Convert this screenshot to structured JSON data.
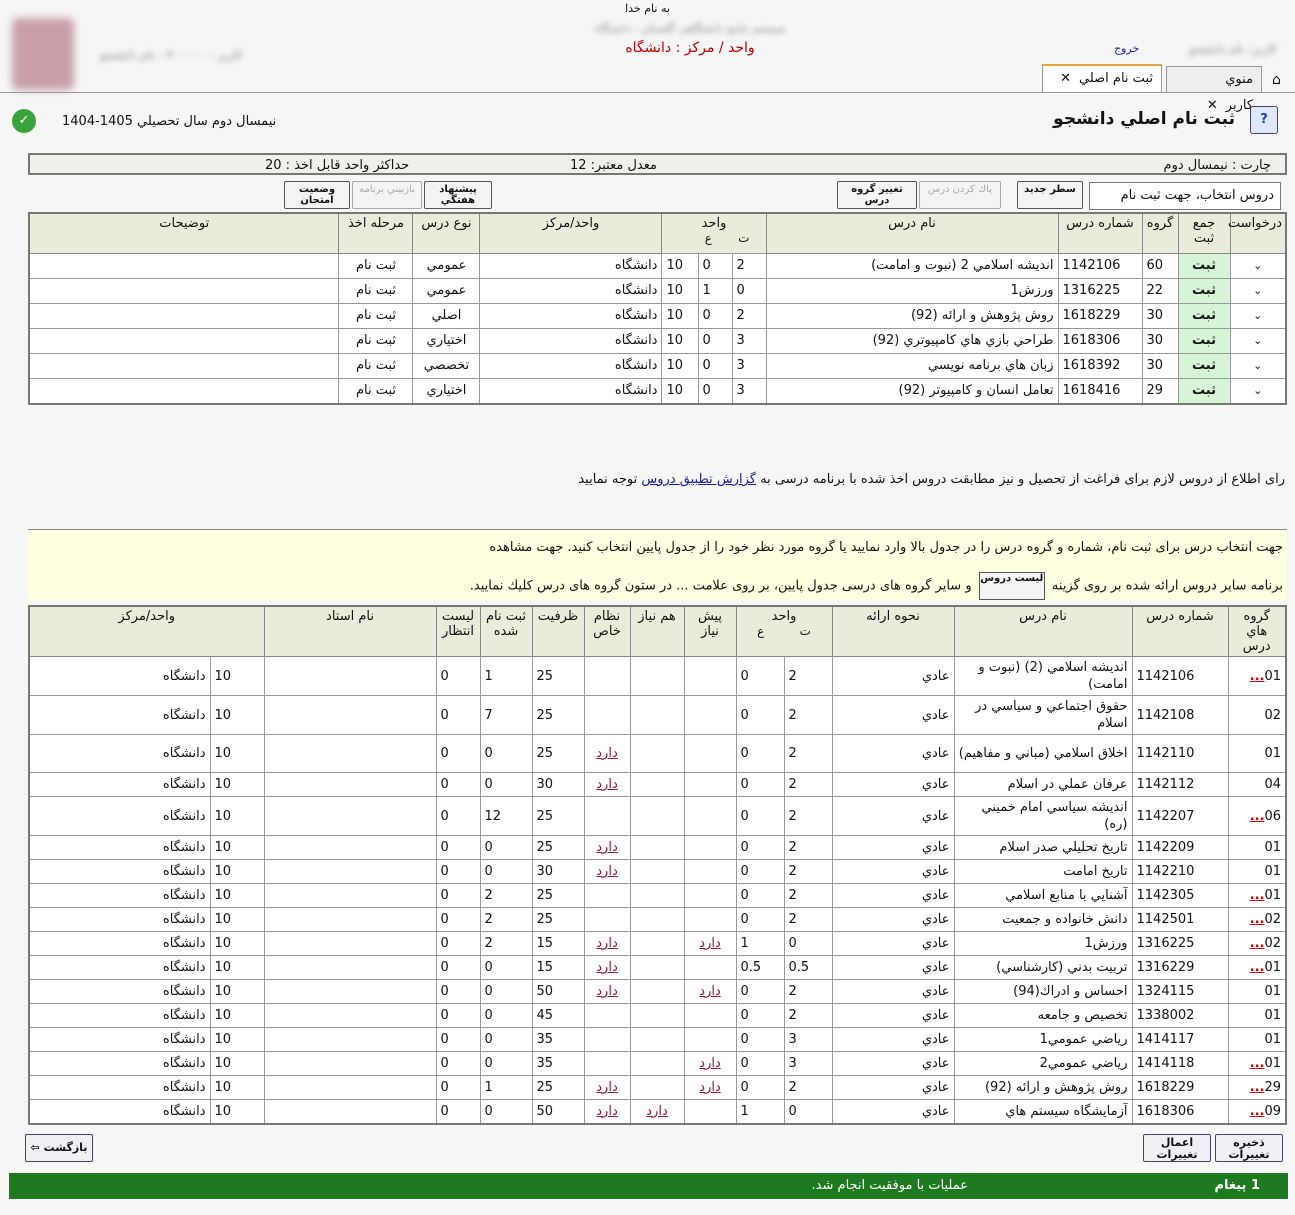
{
  "header": {
    "bismillah": "به نام خدا",
    "university_blurred": "سیستم جامع دانشگاهی گلستان - دانشگاه",
    "unit_line": "واحد / مرکز : دانشگاه",
    "user_blurred": "کاربر : ۴۰۰۰۰۰ - نام دانشجو",
    "user_right_blurred": "کاربر: نام دانشجو",
    "logout": "خروج"
  },
  "tabs": [
    {
      "label": "ثبت نام اصلي",
      "active": true
    },
    {
      "label": "منوي كاربر",
      "active": false
    }
  ],
  "page": {
    "title": "ثبت نام اصلي دانشجو",
    "semester": "نيمسال دوم سال تحصيلي 1405-1404"
  },
  "info": {
    "max_units": "حداكثر واحد قابل اخذ : 20",
    "gpa": "معدل معتبر: 12",
    "chart": "چارت : نيمسال دوم"
  },
  "toolbar": {
    "select_label": "دروس انتخاب، جهت ثبت نام",
    "btn_new_row": "سطر جديد",
    "btn_change_group": "تغيير گروه درس",
    "btn_remove": "پاك كردن درس",
    "btn_suggest": "پيشنهاد هفتگي",
    "btn_review": "بازبيني برنامه",
    "btn_exam": "وضعيت امتحان"
  },
  "table1": {
    "headers": {
      "request": "درخواست",
      "reg_total": "جمع ثبت",
      "group": "گروه",
      "course_no": "شماره درس",
      "course_name": "نام درس",
      "units": "واحد",
      "units_t": "ت",
      "units_p": "ع",
      "unit_center": "واحد/مرکز",
      "type": "نوع درس",
      "stage": "مرحله اخذ",
      "desc": "توضيحات"
    },
    "rows": [
      {
        "status": "ثبت",
        "group": "60",
        "no": "1142106",
        "name": "انديشه اسلامي 2 (نبوت و امامت)",
        "t": "2",
        "p": "0",
        "center_code": "10",
        "center": "دانشگاه",
        "type": "عمومي",
        "stage": "ثبت نام"
      },
      {
        "status": "ثبت",
        "group": "22",
        "no": "1316225",
        "name": "ورزش1",
        "t": "0",
        "p": "1",
        "center_code": "10",
        "center": "دانشگاه",
        "type": "عمومي",
        "stage": "ثبت نام"
      },
      {
        "status": "ثبت",
        "group": "30",
        "no": "1618229",
        "name": "روش پژوهش و ارائه (92)",
        "t": "2",
        "p": "0",
        "center_code": "10",
        "center": "دانشگاه",
        "type": "اصلي",
        "stage": "ثبت نام"
      },
      {
        "status": "ثبت",
        "group": "30",
        "no": "1618306",
        "name": "طراحي بازي هاي كامپيوتري (92)",
        "t": "3",
        "p": "0",
        "center_code": "10",
        "center": "دانشگاه",
        "type": "اختياري",
        "stage": "ثبت نام"
      },
      {
        "status": "ثبت",
        "group": "30",
        "no": "1618392",
        "name": "زبان هاي برنامه نويسي",
        "t": "3",
        "p": "0",
        "center_code": "10",
        "center": "دانشگاه",
        "type": "تخصصي",
        "stage": "ثبت نام"
      },
      {
        "status": "ثبت",
        "group": "29",
        "no": "1618416",
        "name": "تعامل انسان و كامپيوتر (92)",
        "t": "3",
        "p": "0",
        "center_code": "10",
        "center": "دانشگاه",
        "type": "اختياري",
        "stage": "ثبت نام"
      }
    ]
  },
  "notice": {
    "before": "راى اطلاع از دروس لازم براى فراغت از تحصيل و نيز مطابقت دروس اخذ شده با برنامه درسى به",
    "link": "گزارش تطبيق دروس",
    "after": "توجه نماييد"
  },
  "note2": {
    "line1": "جهت انتخاب درس براى ثبت نام، شماره و گروه درس را در جدول بالا وارد نماييد يا گروه مورد نظر خود را از جدول پايين انتخاب كنيد. جهت مشاهده",
    "line2_before": "برنامه ساير دروس ارائه شده بر روى گزينه",
    "btn": "ليست دروس",
    "line2_after": "و ساير گروه هاى درسى جدول پايين، بر روى علامت ... در ستون گروه هاى درس كليك نماييد."
  },
  "table2": {
    "headers": {
      "groups": "گروه هاي درس",
      "course_no": "شماره درس",
      "course_name": "نام درس",
      "mode": "نحوه ارائه",
      "units": "واحد",
      "units_t": "ت",
      "units_p": "ع",
      "prereq": "پيش نياز",
      "coreq": "هم نياز",
      "special": "نظام خاص",
      "capacity": "ظرفيت",
      "registered": "ثبت نام شده",
      "waitlist": "ليست انتظار",
      "teacher": "نام استاد",
      "unit_center": "واحد/مرکز"
    },
    "has_label": "دارد",
    "rows": [
      {
        "group": "01",
        "more": true,
        "no": "1142106",
        "name": "انديشه اسلامي (2) (نبوت و امامت)",
        "mode": "عادي",
        "t": "2",
        "p": "0",
        "pre": "",
        "co": "",
        "sp": "",
        "cap": "25",
        "reg": "1",
        "wait": "0",
        "code": "10",
        "center": "دانشگاه"
      },
      {
        "group": "02",
        "more": false,
        "no": "1142108",
        "name": "حقوق اجتماعي و سياسي در اسلام",
        "mode": "عادي",
        "t": "2",
        "p": "0",
        "pre": "",
        "co": "",
        "sp": "",
        "cap": "25",
        "reg": "7",
        "wait": "0",
        "code": "10",
        "center": "دانشگاه"
      },
      {
        "group": "01",
        "more": false,
        "no": "1142110",
        "name": "اخلاق اسلامي (مباني و مفاهيم)",
        "mode": "عادي",
        "t": "2",
        "p": "0",
        "pre": "",
        "co": "",
        "sp": "دارد",
        "cap": "25",
        "reg": "0",
        "wait": "0",
        "code": "10",
        "center": "دانشگاه"
      },
      {
        "group": "04",
        "more": false,
        "no": "1142112",
        "name": "عرفان عملي در اسلام",
        "mode": "عادي",
        "t": "2",
        "p": "0",
        "pre": "",
        "co": "",
        "sp": "دارد",
        "cap": "30",
        "reg": "0",
        "wait": "0",
        "code": "10",
        "center": "دانشگاه"
      },
      {
        "group": "06",
        "more": true,
        "no": "1142207",
        "name": "انديشه سياسي امام خميني (ره)",
        "mode": "عادي",
        "t": "2",
        "p": "0",
        "pre": "",
        "co": "",
        "sp": "",
        "cap": "25",
        "reg": "12",
        "wait": "0",
        "code": "10",
        "center": "دانشگاه"
      },
      {
        "group": "01",
        "more": false,
        "no": "1142209",
        "name": "تاريخ تحليلي صدر اسلام",
        "mode": "عادي",
        "t": "2",
        "p": "0",
        "pre": "",
        "co": "",
        "sp": "دارد",
        "cap": "25",
        "reg": "0",
        "wait": "0",
        "code": "10",
        "center": "دانشگاه"
      },
      {
        "group": "01",
        "more": false,
        "no": "1142210",
        "name": "تاريخ امامت",
        "mode": "عادي",
        "t": "2",
        "p": "0",
        "pre": "",
        "co": "",
        "sp": "دارد",
        "cap": "30",
        "reg": "0",
        "wait": "0",
        "code": "10",
        "center": "دانشگاه"
      },
      {
        "group": "01",
        "more": true,
        "no": "1142305",
        "name": "آشنايي با منابع اسلامي",
        "mode": "عادي",
        "t": "2",
        "p": "0",
        "pre": "",
        "co": "",
        "sp": "",
        "cap": "25",
        "reg": "2",
        "wait": "0",
        "code": "10",
        "center": "دانشگاه"
      },
      {
        "group": "02",
        "more": true,
        "no": "1142501",
        "name": "دانش خانواده و جمعيت",
        "mode": "عادي",
        "t": "2",
        "p": "0",
        "pre": "",
        "co": "",
        "sp": "",
        "cap": "25",
        "reg": "2",
        "wait": "0",
        "code": "10",
        "center": "دانشگاه"
      },
      {
        "group": "02",
        "more": true,
        "no": "1316225",
        "name": "ورزش1",
        "mode": "عادي",
        "t": "0",
        "p": "1",
        "pre": "دارد",
        "co": "",
        "sp": "دارد",
        "cap": "15",
        "reg": "2",
        "wait": "0",
        "code": "10",
        "center": "دانشگاه"
      },
      {
        "group": "01",
        "more": true,
        "no": "1316229",
        "name": "تربيت بدني (كارشناسي)",
        "mode": "عادي",
        "t": "0.5",
        "p": "0.5",
        "pre": "",
        "co": "",
        "sp": "دارد",
        "cap": "15",
        "reg": "0",
        "wait": "0",
        "code": "10",
        "center": "دانشگاه"
      },
      {
        "group": "01",
        "more": false,
        "no": "1324115",
        "name": "احساس و ادراك(94)",
        "mode": "عادي",
        "t": "2",
        "p": "0",
        "pre": "دارد",
        "co": "",
        "sp": "دارد",
        "cap": "50",
        "reg": "0",
        "wait": "0",
        "code": "10",
        "center": "دانشگاه"
      },
      {
        "group": "01",
        "more": false,
        "no": "1338002",
        "name": "تخصيص و جامعه",
        "mode": "عادي",
        "t": "2",
        "p": "0",
        "pre": "",
        "co": "",
        "sp": "",
        "cap": "45",
        "reg": "0",
        "wait": "0",
        "code": "10",
        "center": "دانشگاه"
      },
      {
        "group": "01",
        "more": false,
        "no": "1414117",
        "name": "رياضي عمومي1",
        "mode": "عادي",
        "t": "3",
        "p": "0",
        "pre": "",
        "co": "",
        "sp": "",
        "cap": "35",
        "reg": "0",
        "wait": "0",
        "code": "10",
        "center": "دانشگاه"
      },
      {
        "group": "01",
        "more": true,
        "no": "1414118",
        "name": "رياضي عمومي2",
        "mode": "عادي",
        "t": "3",
        "p": "0",
        "pre": "دارد",
        "co": "",
        "sp": "",
        "cap": "35",
        "reg": "0",
        "wait": "0",
        "code": "10",
        "center": "دانشگاه"
      },
      {
        "group": "29",
        "more": true,
        "no": "1618229",
        "name": "روش پژوهش و ارائه (92)",
        "mode": "عادي",
        "t": "2",
        "p": "0",
        "pre": "دارد",
        "co": "",
        "sp": "دارد",
        "cap": "25",
        "reg": "1",
        "wait": "0",
        "code": "10",
        "center": "دانشگاه"
      },
      {
        "group": "09",
        "more": true,
        "no": "1618306",
        "name": "آزمايشگاه سيستم هاي",
        "mode": "عادي",
        "t": "0",
        "p": "1",
        "pre": "",
        "co": "دارد",
        "sp": "دارد",
        "cap": "50",
        "reg": "0",
        "wait": "0",
        "code": "10",
        "center": "دانشگاه"
      }
    ]
  },
  "footer": {
    "back": "بازگشت",
    "apply": "اعمال تغييرات",
    "save": "ذخيره تغييرات",
    "status_count": "1 پيغام",
    "status_msg": "عمليات با موفقيت انجام شد."
  },
  "colors": {
    "status_bar": "#1e7a1e",
    "registered_cell": "#d6f5d6",
    "header_bg": "#ebebdc",
    "unit_line": "#b00000"
  }
}
